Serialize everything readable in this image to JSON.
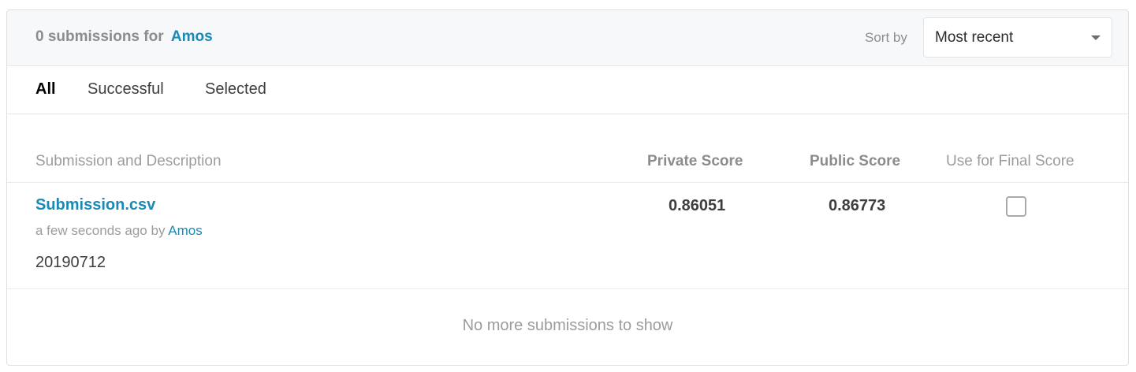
{
  "header": {
    "title_prefix": "0 submissions for",
    "user": "Amos",
    "sort_label": "Sort by",
    "sort_value": "Most recent"
  },
  "tabs": [
    {
      "label": "All",
      "active": true
    },
    {
      "label": "Successful",
      "active": false
    },
    {
      "label": "Selected",
      "active": false
    }
  ],
  "columns": {
    "submission": "Submission and Description",
    "private": "Private Score",
    "public": "Public Score",
    "final": "Use for Final Score"
  },
  "submissions": [
    {
      "name": "Submission.csv",
      "time": "a few seconds ago by",
      "user": "Amos",
      "description": "20190712",
      "private_score": "0.86051",
      "public_score": "0.86773",
      "selected": false
    }
  ],
  "footer": {
    "no_more": "No more submissions to show"
  },
  "colors": {
    "link": "#1a8ab5",
    "header_bg": "#f7f8f9"
  }
}
